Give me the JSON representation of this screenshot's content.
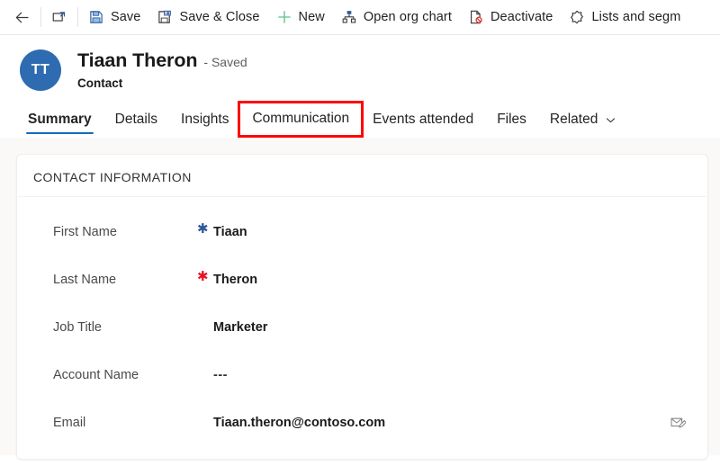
{
  "commandbar": {
    "items": [
      {
        "icon": "back-arrow-icon",
        "label": ""
      },
      {
        "icon": "popout-icon",
        "label": ""
      },
      {
        "icon": "save-icon",
        "label": "Save"
      },
      {
        "icon": "save-and-close-icon",
        "label": "Save & Close"
      },
      {
        "icon": "plus-icon",
        "label": "New"
      },
      {
        "icon": "org-chart-icon",
        "label": "Open org chart"
      },
      {
        "icon": "deactivate-icon",
        "label": "Deactivate"
      },
      {
        "icon": "lists-segments-icon",
        "label": "Lists and segm"
      }
    ]
  },
  "record_header": {
    "avatar_initials": "TT",
    "title": "Tiaan Theron",
    "status": "- Saved",
    "subtitle": "Contact",
    "avatar_color": "#2f6bb0"
  },
  "tabs": {
    "items": [
      {
        "label": "Summary",
        "active": true,
        "highlighted": false,
        "chevron": false
      },
      {
        "label": "Details",
        "active": false,
        "highlighted": false,
        "chevron": false
      },
      {
        "label": "Insights",
        "active": false,
        "highlighted": false,
        "chevron": false
      },
      {
        "label": "Communication",
        "active": false,
        "highlighted": true,
        "chevron": false
      },
      {
        "label": "Events attended",
        "active": false,
        "highlighted": false,
        "chevron": false
      },
      {
        "label": "Files",
        "active": false,
        "highlighted": false,
        "chevron": false
      },
      {
        "label": "Related",
        "active": false,
        "highlighted": false,
        "chevron": true
      }
    ],
    "active_underline_color": "#0f6cbd",
    "highlight_box_color": "#ff0000"
  },
  "card": {
    "section_title": "CONTACT INFORMATION",
    "fields": [
      {
        "label": "First Name",
        "required": "recommended",
        "value": "Tiaan",
        "action_icon": ""
      },
      {
        "label": "Last Name",
        "required": "required",
        "value": "Theron",
        "action_icon": ""
      },
      {
        "label": "Job Title",
        "required": "none",
        "value": "Marketer",
        "action_icon": ""
      },
      {
        "label": "Account Name",
        "required": "none",
        "value": "---",
        "action_icon": ""
      },
      {
        "label": "Email",
        "required": "none",
        "value": "Tiaan.theron@contoso.com",
        "action_icon": "email-compose-icon"
      }
    ]
  }
}
